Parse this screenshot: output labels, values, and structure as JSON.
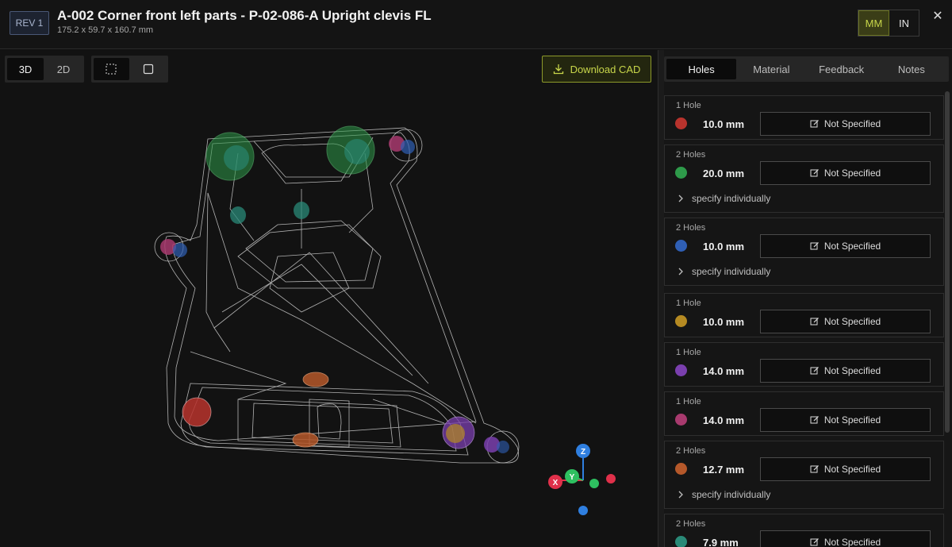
{
  "header": {
    "revision": "REV 1",
    "title": "A-002 Corner front left parts - P-02-086-A Upright clevis FL",
    "dimensions": "175.2 x 59.7 x 160.7 mm",
    "units": {
      "mm": "MM",
      "in": "IN",
      "selected": "MM"
    },
    "close": "✕"
  },
  "viewer": {
    "view_modes": [
      "3D",
      "2D"
    ],
    "selected_view": "3D",
    "download_label": "Download CAD",
    "axes": {
      "z": "Z",
      "y": "Y",
      "x": "X"
    }
  },
  "panel": {
    "tabs": [
      "Holes",
      "Material",
      "Feedback",
      "Notes"
    ],
    "active_tab": "Holes",
    "holes": [
      {
        "count": "1 Hole",
        "size": "10.0 mm",
        "color": "#b8332d",
        "status": "Not Specified",
        "expand": ""
      },
      {
        "count": "2 Holes",
        "size": "20.0 mm",
        "color": "#2e9a4a",
        "status": "Not Specified",
        "expand": "specify individually"
      },
      {
        "count": "2 Holes",
        "size": "10.0 mm",
        "color": "#2f5fb5",
        "status": "Not Specified",
        "expand": "specify individually"
      },
      {
        "count": "1 Hole",
        "size": "10.0 mm",
        "color": "#b58a22",
        "status": "Not Specified",
        "expand": ""
      },
      {
        "count": "1 Hole",
        "size": "14.0 mm",
        "color": "#7a3fae",
        "status": "Not Specified",
        "expand": ""
      },
      {
        "count": "1 Hole",
        "size": "14.0 mm",
        "color": "#a83a6e",
        "status": "Not Specified",
        "expand": ""
      },
      {
        "count": "2 Holes",
        "size": "12.7 mm",
        "color": "#b5582a",
        "status": "Not Specified",
        "expand": "specify individually"
      },
      {
        "count": "2 Holes",
        "size": "7.9 mm",
        "color": "#2a8a78",
        "status": "Not Specified",
        "expand": ""
      }
    ]
  }
}
